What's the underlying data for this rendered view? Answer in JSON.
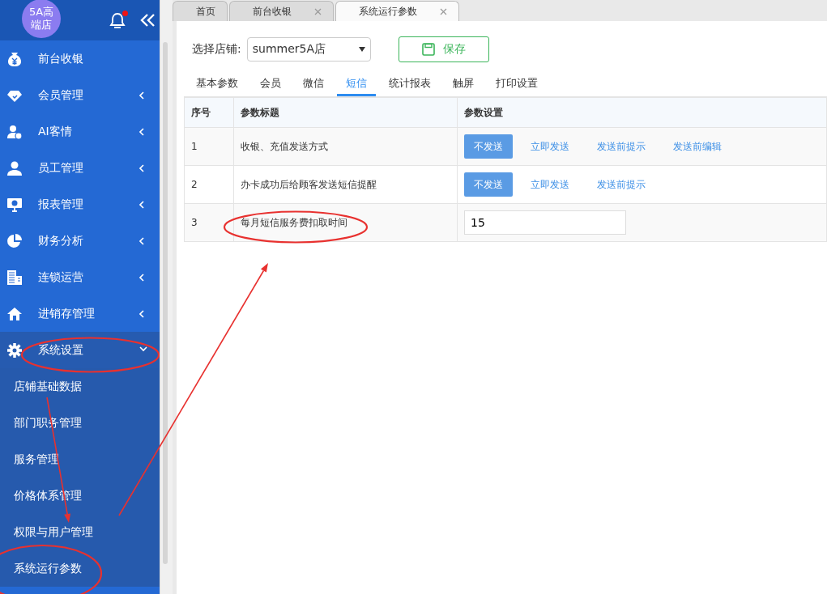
{
  "sidebar": {
    "store_badge": "5A高端店",
    "notification": true,
    "items": [
      {
        "label": "前台收银",
        "expandable": false,
        "expanded": false,
        "circled": false
      },
      {
        "label": "会员管理",
        "expandable": true,
        "expanded": false,
        "circled": false
      },
      {
        "label": "AI客情",
        "expandable": true,
        "expanded": false,
        "circled": false
      },
      {
        "label": "员工管理",
        "expandable": true,
        "expanded": false,
        "circled": false
      },
      {
        "label": "报表管理",
        "expandable": true,
        "expanded": false,
        "circled": false
      },
      {
        "label": "财务分析",
        "expandable": true,
        "expanded": false,
        "circled": false
      },
      {
        "label": "连锁运营",
        "expandable": true,
        "expanded": false,
        "circled": false
      },
      {
        "label": "进销存管理",
        "expandable": true,
        "expanded": false,
        "circled": false
      },
      {
        "label": "系统设置",
        "expandable": true,
        "expanded": true,
        "circled": true,
        "children": [
          {
            "label": "店铺基础数据",
            "circled": false
          },
          {
            "label": "部门职务管理",
            "circled": false
          },
          {
            "label": "服务管理",
            "circled": false
          },
          {
            "label": "价格体系管理",
            "circled": false
          },
          {
            "label": "权限与用户管理",
            "circled": false
          },
          {
            "label": "系统运行参数",
            "circled": true
          }
        ]
      }
    ]
  },
  "page_tabs": [
    {
      "label": "首页",
      "selected": false,
      "closable": false
    },
    {
      "label": "前台收银",
      "selected": false,
      "closable": true
    },
    {
      "label": "系统运行参数",
      "selected": true,
      "closable": true
    }
  ],
  "store_select": {
    "label": "选择店铺:",
    "value": "summer5A店"
  },
  "save_button": "保存",
  "settings_tabs": [
    {
      "label": "基本参数",
      "selected": false
    },
    {
      "label": "会员",
      "selected": false
    },
    {
      "label": "微信",
      "selected": false
    },
    {
      "label": "短信",
      "selected": true
    },
    {
      "label": "统计报表",
      "selected": false
    },
    {
      "label": "触屏",
      "selected": false
    },
    {
      "label": "打印设置",
      "selected": false
    }
  ],
  "table": {
    "columns": [
      "序号",
      "参数标题",
      "参数设置"
    ],
    "rows": [
      {
        "index": "1",
        "title": "收银、充值发送方式",
        "circled": false,
        "kind": "options",
        "options": [
          {
            "label": "不发送",
            "selected": true
          },
          {
            "label": "立即发送",
            "selected": false
          },
          {
            "label": "发送前提示",
            "selected": false
          },
          {
            "label": "发送前编辑",
            "selected": false
          }
        ]
      },
      {
        "index": "2",
        "title": "办卡成功后给顾客发送短信提醒",
        "circled": false,
        "kind": "options",
        "options": [
          {
            "label": "不发送",
            "selected": true
          },
          {
            "label": "立即发送",
            "selected": false
          },
          {
            "label": "发送前提示",
            "selected": false
          }
        ]
      },
      {
        "index": "3",
        "title": "每月短信服务费扣取时间",
        "circled": true,
        "kind": "input",
        "value": "15"
      }
    ]
  },
  "annotation_arrows": [
    {
      "kind": "arrow"
    },
    {
      "kind": "arrow"
    }
  ]
}
